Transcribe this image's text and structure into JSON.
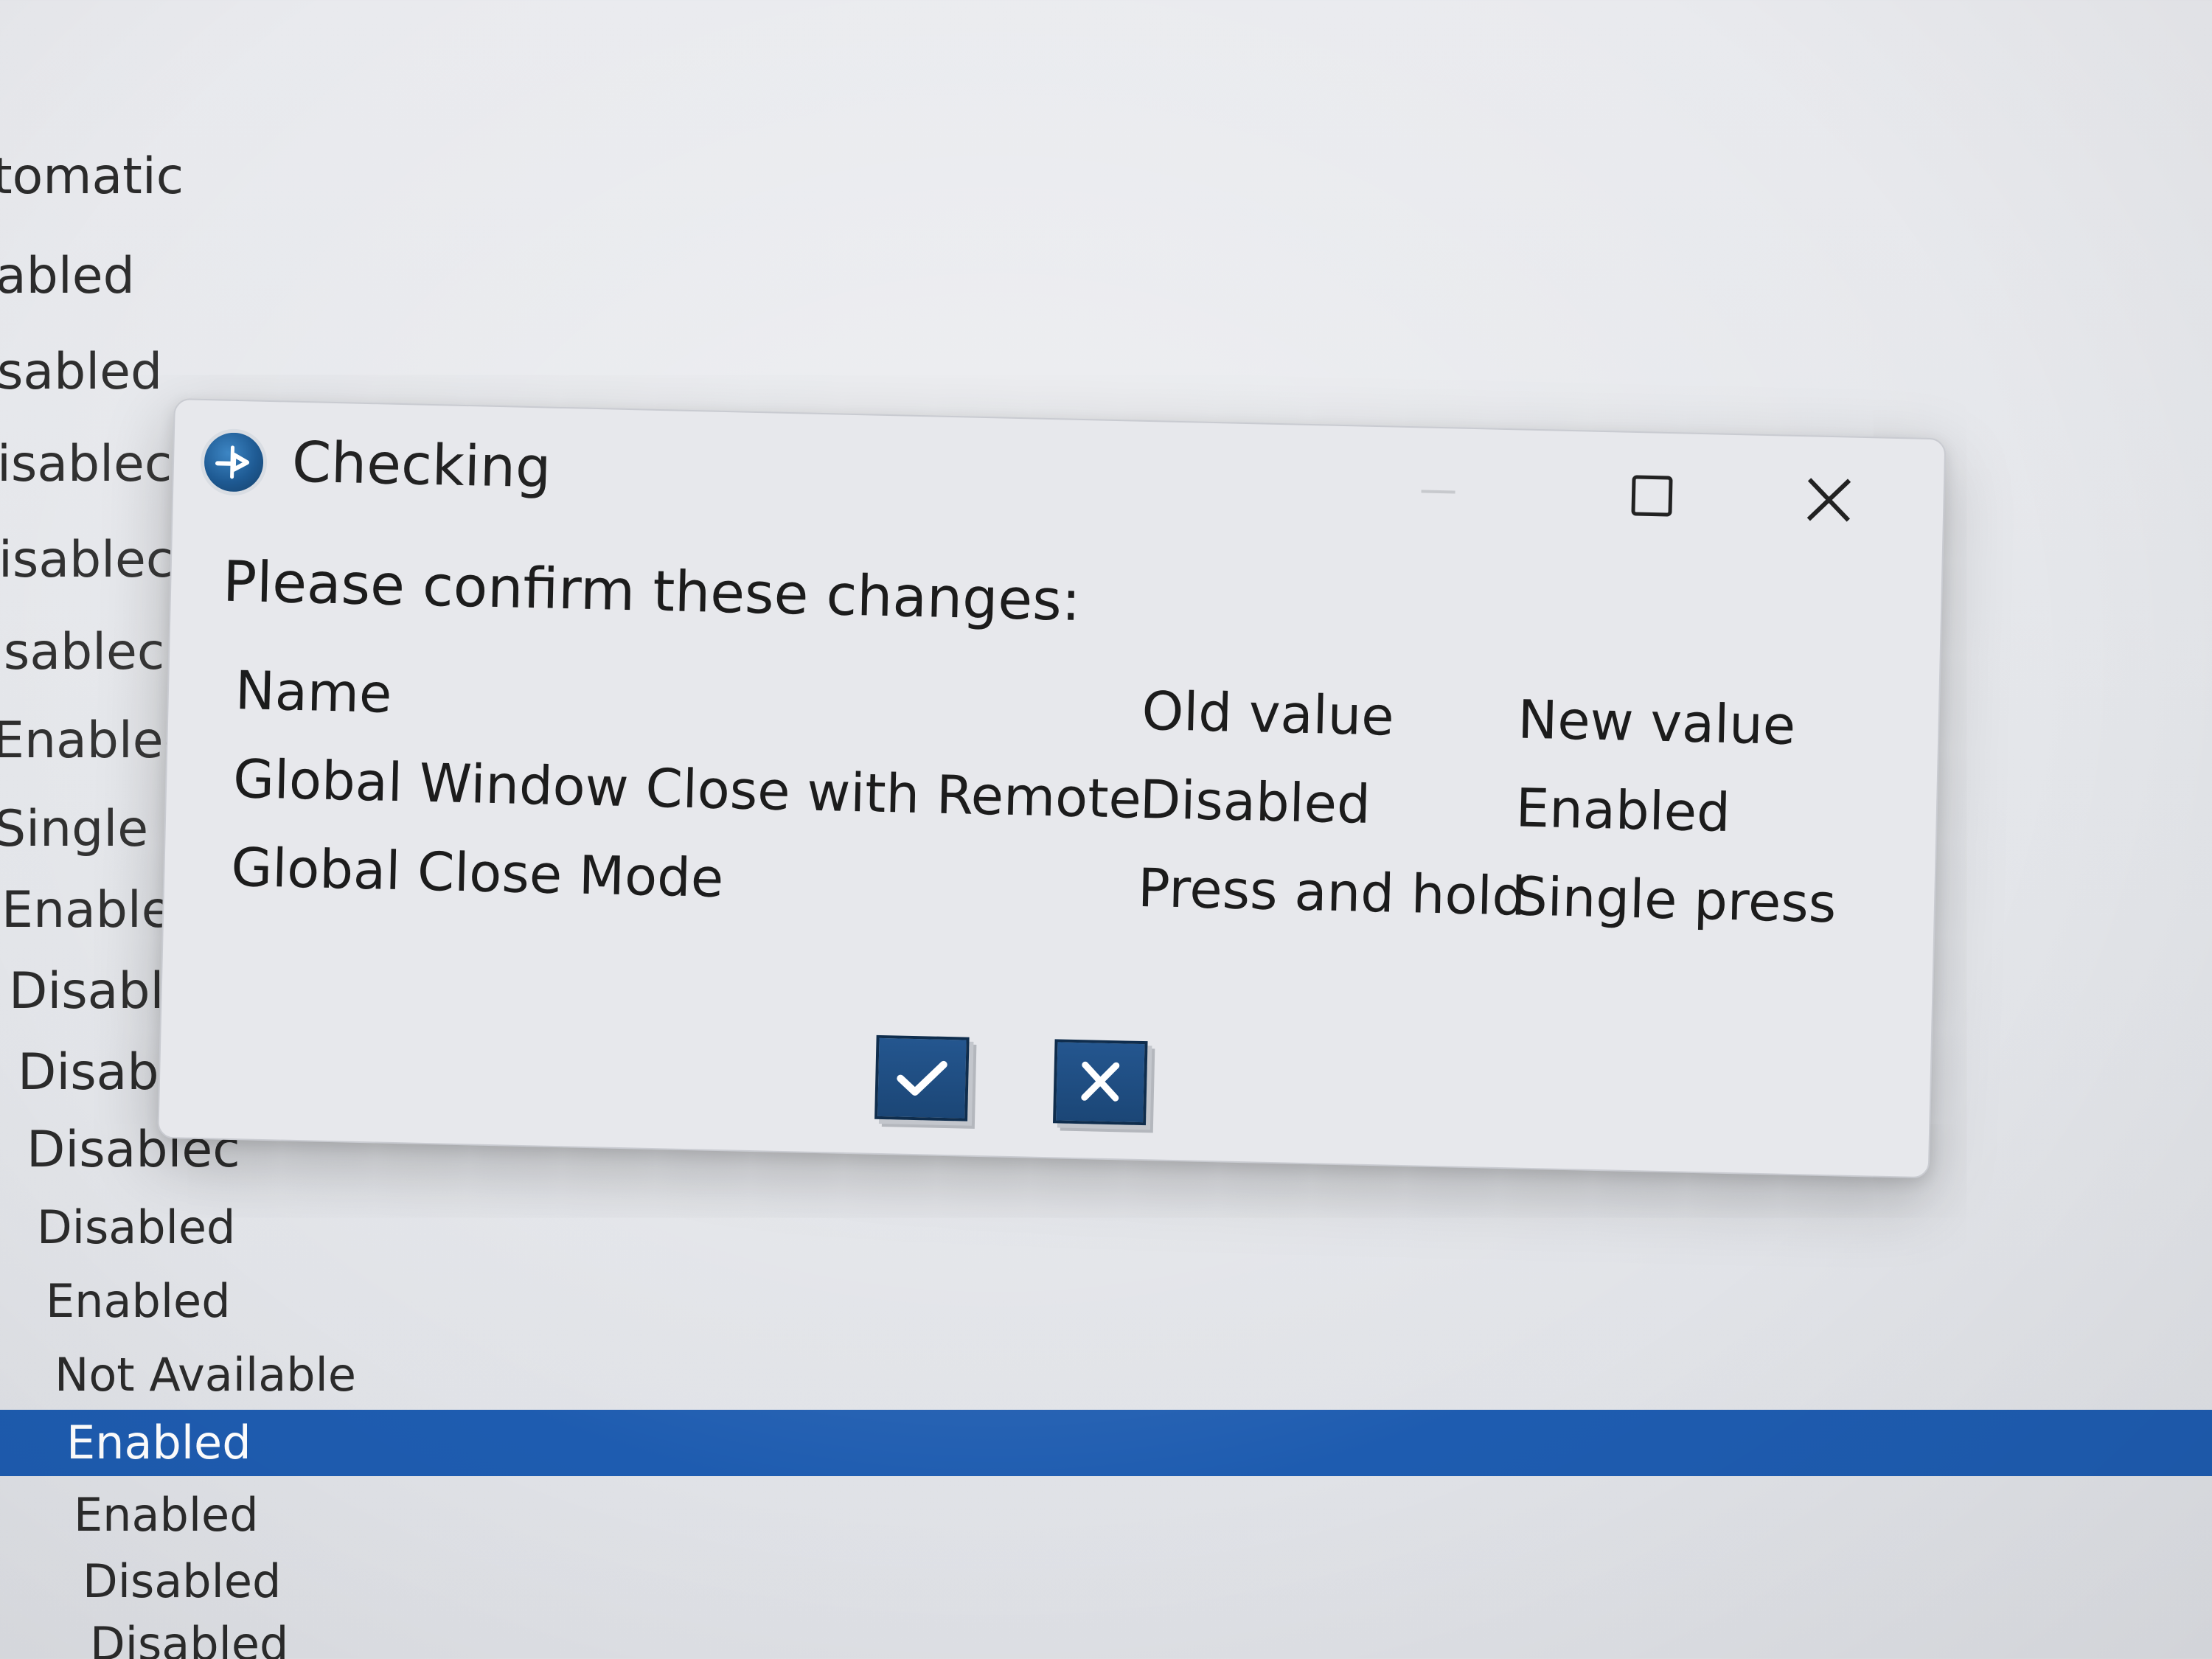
{
  "background_list": {
    "items": [
      {
        "label": "tomatic"
      },
      {
        "label": "abled"
      },
      {
        "label": "sabled"
      },
      {
        "label": "isablec"
      },
      {
        "label": "isablec"
      },
      {
        "label": "isablec"
      },
      {
        "label": "Enabled"
      },
      {
        "label": "Single p"
      },
      {
        "label": "Enabled"
      },
      {
        "label": "Disablec"
      },
      {
        "label": "Disablec"
      },
      {
        "label": "Disablec"
      },
      {
        "label": "Disabled"
      },
      {
        "label": "Enabled"
      },
      {
        "label": "Not Available"
      },
      {
        "label": "Enabled",
        "selected": true
      },
      {
        "label": "Enabled"
      },
      {
        "label": "Disabled"
      },
      {
        "label": "Disabled"
      }
    ],
    "selected_color": "#1e5cb0"
  },
  "dialog": {
    "title": "Checking",
    "icon": "app-logo-icon",
    "window_buttons": [
      "minimize-icon",
      "maximize-icon",
      "close-icon"
    ],
    "prompt": "Please confirm these changes:",
    "columns": {
      "name": "Name",
      "old": "Old value",
      "new": "New value"
    },
    "rows": [
      {
        "name": "Global Window Close with Remote",
        "old": "Disabled",
        "new": "Enabled"
      },
      {
        "name": "Global Close Mode",
        "old": "Press and hold",
        "new": "Single press"
      }
    ],
    "buttons": {
      "confirm_icon": "checkmark-icon",
      "cancel_icon": "cross-icon",
      "color": "#1b4676"
    }
  }
}
